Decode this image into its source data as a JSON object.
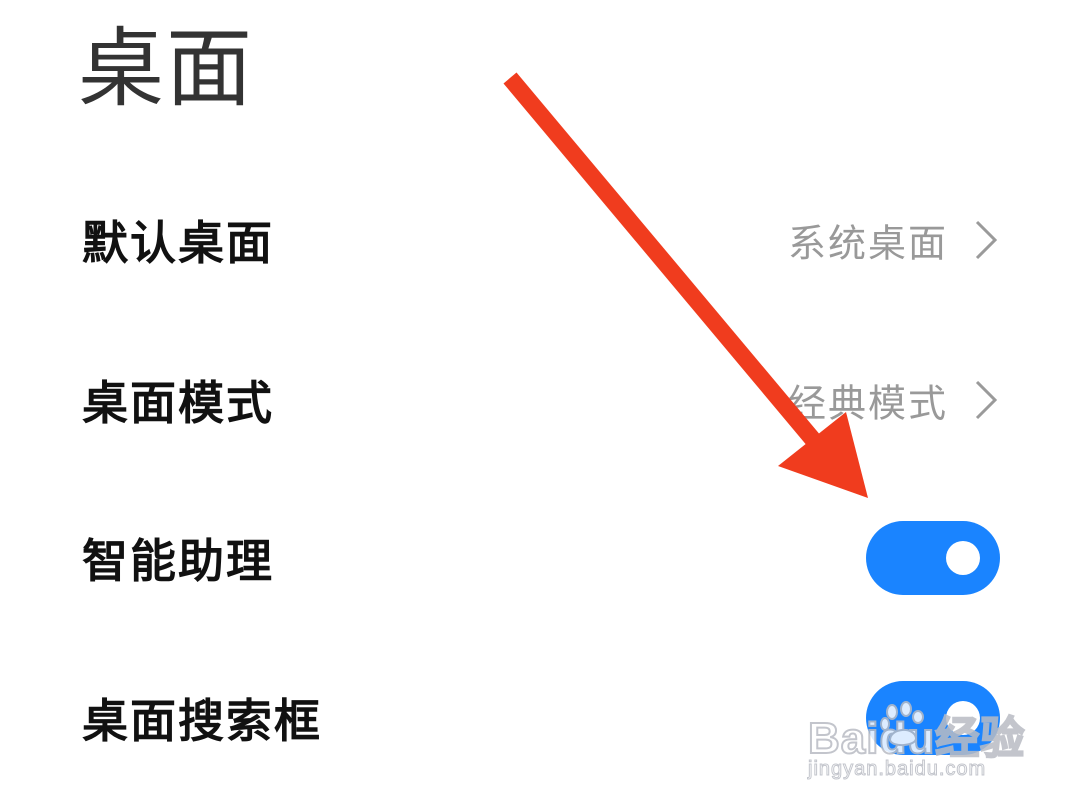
{
  "page": {
    "title": "桌面"
  },
  "settings": [
    {
      "label": "默认桌面",
      "value": "系统桌面",
      "type": "link"
    },
    {
      "label": "桌面模式",
      "value": "经典模式",
      "type": "link"
    },
    {
      "label": "智能助理",
      "type": "toggle",
      "on": true
    },
    {
      "label": "桌面搜索框",
      "type": "toggle",
      "on": true
    }
  ],
  "colors": {
    "accent": "#1a84ff",
    "arrow": "#f03c1e",
    "secondary_text": "#999999"
  },
  "icons": {
    "chevron": "chevron-right-icon",
    "annotation": "red-arrow-annotation"
  },
  "watermark": {
    "logo": "Baidu经验",
    "url": "jingyan.baidu.com"
  }
}
